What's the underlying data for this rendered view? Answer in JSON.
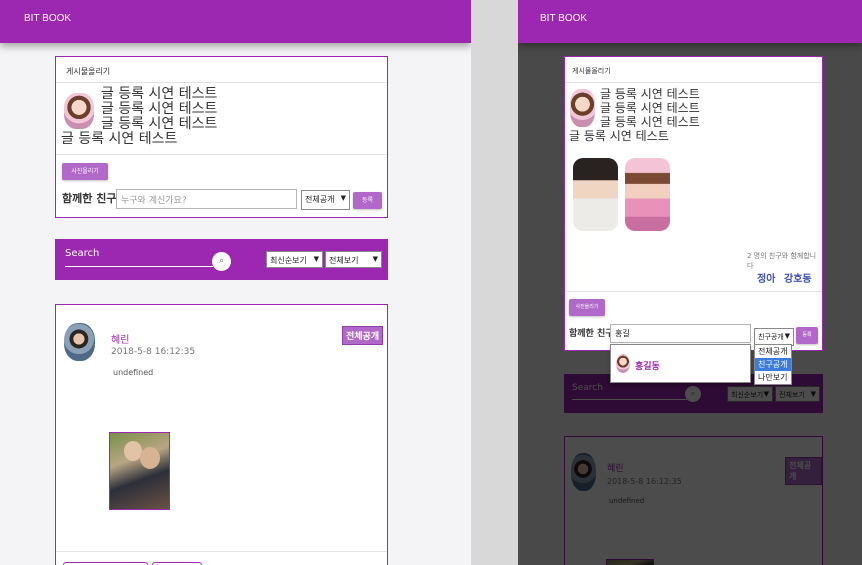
{
  "app": {
    "brand": "BIT BOOK"
  },
  "composer": {
    "title": "게시물올리기",
    "lines": [
      "글 등록 시연 테스트",
      "글 등록 시연 테스트",
      "글 등록 시연 테스트",
      "글 등록 시연 테스트"
    ],
    "photo_button": "사진올리기",
    "friends_label": "함께한 친구",
    "friends_placeholder": "누구와 계신가요?",
    "visibility_selected": "전체공개",
    "submit_label": "등록"
  },
  "search": {
    "placeholder": "Search",
    "sort_selected": "최신순보기",
    "filter_selected": "전체보기"
  },
  "post": {
    "author": "혜린",
    "date": "2018-5-8 16:12:35",
    "body": "undefined",
    "visibility_badge": "전체공개"
  },
  "right_composer": {
    "friends_input_value": "홍길",
    "visibility_selected": "친구공개",
    "visibility_options": [
      "전체공개",
      "친구공개",
      "나만보기"
    ],
    "with_note": "2 명의 친구와 함께합니다",
    "tagged_friends": [
      "정아",
      "강호동"
    ],
    "suggestion": {
      "name": "홍길동"
    }
  },
  "icons": {
    "search": "search-icon",
    "dropdown": "chevron-down-icon"
  },
  "colors": {
    "primary": "#9c27b0",
    "button": "#b069c9",
    "link": "#3f51b5"
  }
}
